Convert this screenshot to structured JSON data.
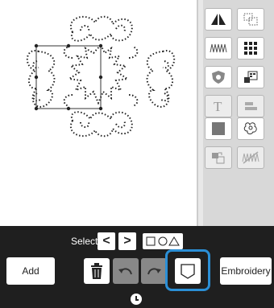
{
  "toolbar": {
    "select_label": "Select",
    "prev_symbol": "<",
    "next_symbol": ">",
    "add_label": "Add",
    "embroidery_label": "Embroidery"
  },
  "right_panel": {
    "tools": [
      {
        "name": "mirror-icon"
      },
      {
        "name": "frame-icon"
      },
      {
        "name": "density-icon"
      },
      {
        "name": "pattern-grid-icon"
      },
      {
        "name": "shield-icon"
      },
      {
        "name": "layers-icon"
      },
      {
        "name": "text-icon"
      },
      {
        "name": "align-icon"
      },
      {
        "name": "fill-icon"
      },
      {
        "name": "applique-icon"
      },
      {
        "name": "duplicate-icon"
      },
      {
        "name": "stitch-off-icon"
      }
    ]
  },
  "colors": {
    "accent": "#2b8fd6",
    "bar": "#1f1f1f",
    "delete": "#c0392b"
  }
}
